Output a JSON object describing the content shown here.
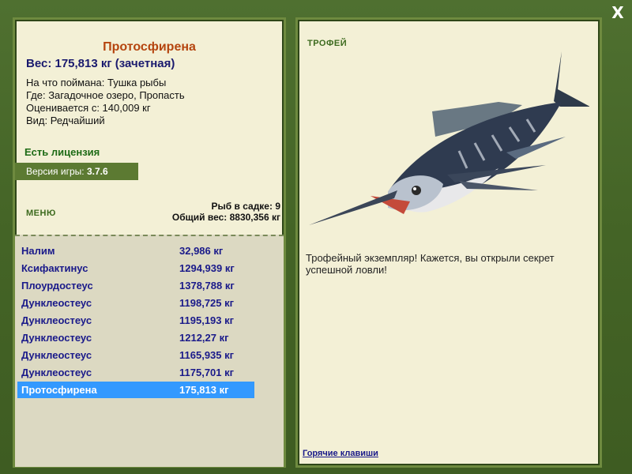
{
  "window": {
    "close_label": "X"
  },
  "details": {
    "fish_name": "Протосфирена",
    "weight_line": "Вес: 175,813 кг (зачетная)",
    "bait_line": "На что поймана: Тушка рыбы",
    "location_line": "Где: Загадочное озеро, Пропасть",
    "valued_line": "Оценивается с: 140,009 кг",
    "rarity_line": "Вид: Редчайший",
    "license": "Есть лицензия",
    "version_prefix": "Версия игры:",
    "version": "3.7.6"
  },
  "menu": {
    "label": "МЕНЮ"
  },
  "keepnet": {
    "count_line": "Рыб в садке: 9",
    "total_line": "Общий вес: 8830,356 кг",
    "rows": [
      {
        "name": "Налим",
        "weight": "32,986 кг"
      },
      {
        "name": "Ксифактинус",
        "weight": "1294,939 кг"
      },
      {
        "name": "Плоурдостеус",
        "weight": "1378,788 кг"
      },
      {
        "name": "Дунклеостеус",
        "weight": "1198,725 кг"
      },
      {
        "name": "Дунклеостеус",
        "weight": "1195,193 кг"
      },
      {
        "name": "Дунклеостеус",
        "weight": "1212,27 кг"
      },
      {
        "name": "Дунклеостеус",
        "weight": "1165,935 кг"
      },
      {
        "name": "Дунклеостеус",
        "weight": "1175,701 кг"
      },
      {
        "name": "Протосфирена",
        "weight": "175,813 кг",
        "selected": true
      }
    ]
  },
  "trophy": {
    "label": "ТРОФЕЙ",
    "description": "Трофейный экземпляр! Кажется, вы открыли секрет успешной ловли!",
    "hotkeys_link": "Горячие клавиши"
  },
  "colors": {
    "frame_green": "#4a6a2a",
    "panel_bg": "#f3f0d6",
    "selection": "#3399ff",
    "title_orange": "#b5450f",
    "link_blue": "#1a1a8a"
  }
}
